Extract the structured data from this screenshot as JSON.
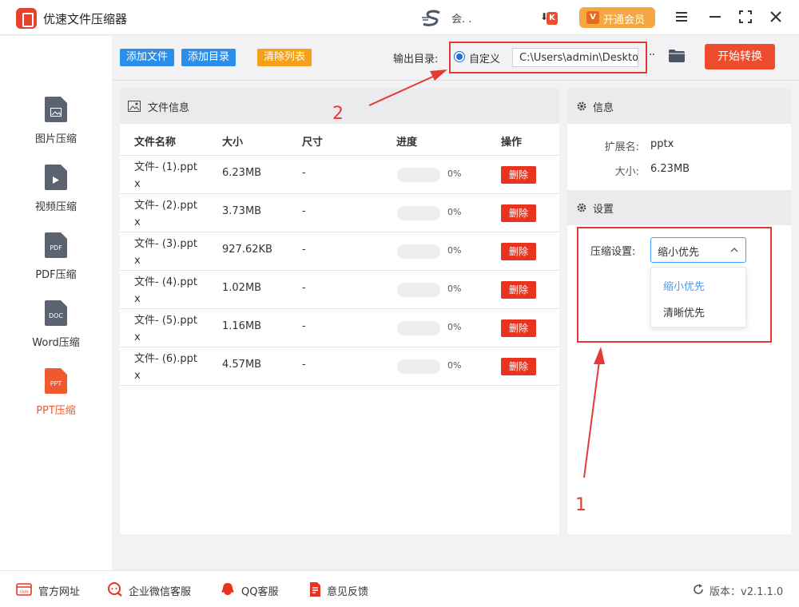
{
  "app": {
    "title": "优速文件压缩器",
    "user": "会. ."
  },
  "header": {
    "vip_label": "开通会员",
    "vip_icon": "V",
    "notify_icon": "K"
  },
  "sidebar": {
    "items": [
      {
        "label": "图片压缩",
        "icon": "image-doc-icon",
        "badge": ""
      },
      {
        "label": "视频压缩",
        "icon": "video-doc-icon",
        "badge": ""
      },
      {
        "label": "PDF压缩",
        "icon": "pdf-doc-icon",
        "badge": "PDF"
      },
      {
        "label": "Word压缩",
        "icon": "doc-doc-icon",
        "badge": "DOC"
      },
      {
        "label": "PPT压缩",
        "icon": "ppt-doc-icon",
        "badge": "PPT",
        "active": true
      }
    ]
  },
  "toolbar": {
    "add_file": "添加文件",
    "add_dir": "添加目录",
    "clear_list": "清除列表",
    "output_label": "输出目录:",
    "custom_label": "自定义",
    "output_path": "C:\\Users\\admin\\Desktop",
    "more": "··",
    "start": "开始转换"
  },
  "file_panel": {
    "title": "文件信息",
    "columns": [
      "文件名称",
      "大小",
      "尺寸",
      "进度",
      "操作"
    ],
    "rows": [
      {
        "name": "文件- (1).pptx",
        "size": "6.23MB",
        "dim": "-",
        "progress": "0%",
        "action": "删除"
      },
      {
        "name": "文件- (2).pptx",
        "size": "3.73MB",
        "dim": "-",
        "progress": "0%",
        "action": "删除"
      },
      {
        "name": "文件- (3).pptx",
        "size": "927.62KB",
        "dim": "-",
        "progress": "0%",
        "action": "删除"
      },
      {
        "name": "文件- (4).pptx",
        "size": "1.02MB",
        "dim": "-",
        "progress": "0%",
        "action": "删除"
      },
      {
        "name": "文件- (5).pptx",
        "size": "1.16MB",
        "dim": "-",
        "progress": "0%",
        "action": "删除"
      },
      {
        "name": "文件- (6).pptx",
        "size": "4.57MB",
        "dim": "-",
        "progress": "0%",
        "action": "删除"
      }
    ]
  },
  "info_panel": {
    "title": "信息",
    "ext_label": "扩展名:",
    "ext_value": "pptx",
    "size_label": "大小:",
    "size_value": "6.23MB"
  },
  "settings": {
    "title": "设置",
    "compress_label": "压缩设置:",
    "selected": "缩小优先",
    "options": [
      "缩小优先",
      "清晰优先"
    ]
  },
  "annotations": {
    "one": "1",
    "two": "2"
  },
  "footer": {
    "website": "官方网址",
    "wechat": "企业微信客服",
    "qq": "QQ客服",
    "feedback": "意见反馈",
    "version": "版本：v2.1.1.0",
    "website_icon_text": "com"
  },
  "colors": {
    "accent_red": "#ee4d2d",
    "accent_blue": "#2b8ee8",
    "accent_orange": "#f5a01a",
    "annotation_red": "#e53935",
    "select_blue": "#409eff"
  }
}
